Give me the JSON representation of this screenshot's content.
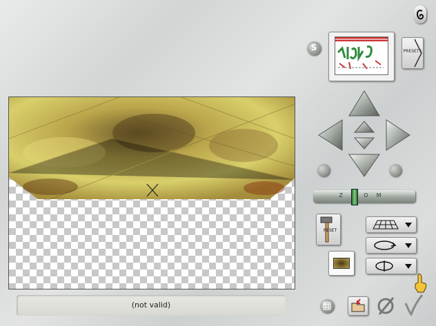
{
  "status": {
    "text": "(not valid)"
  },
  "presets": {
    "label": "PRESETS"
  },
  "reset": {
    "label": "RESET"
  },
  "zoom": {
    "label": "ZOOM",
    "level": 0.4
  },
  "icons": {
    "help": "help-e-icon",
    "style": "s-icon",
    "nav_up": "arrow-up-icon",
    "nav_down": "arrow-down-icon",
    "nav_left": "arrow-left-icon",
    "nav_right": "arrow-right-icon",
    "rotate_ccw": "rotate-left-icon",
    "rotate_cw": "rotate-right-icon",
    "grid": "grid-icon",
    "folder": "folder-icon",
    "cancel": "cancel-icon",
    "ok": "check-icon",
    "hint": "pointing-hand-icon"
  },
  "colors": {
    "accent_green": "#3f8a3f",
    "panel": "#d7d9d9"
  }
}
